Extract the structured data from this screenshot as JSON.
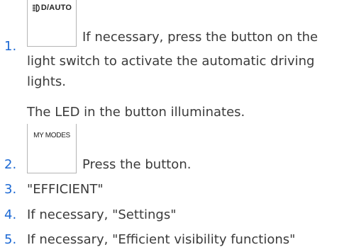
{
  "steps": [
    {
      "number": "1.",
      "button_label": "D/AUTO",
      "icon": "headlight-icon",
      "lines": [
        "If necessary, press the button on the",
        "light switch to activate the automatic driving",
        "lights."
      ],
      "note": "The LED in the button illuminates."
    },
    {
      "number": "2.",
      "button_label": "MY MODES",
      "text": "Press the button."
    },
    {
      "number": "3.",
      "text": "\"EFFICIENT\""
    },
    {
      "number": "4.",
      "text": "If necessary, \"Settings\""
    },
    {
      "number": "5.",
      "text": "If necessary, \"Efficient visibility functions\""
    }
  ],
  "colors": {
    "number": "#1c69d4",
    "text": "#3b3b3b",
    "button_border": "#b5b5b5"
  }
}
